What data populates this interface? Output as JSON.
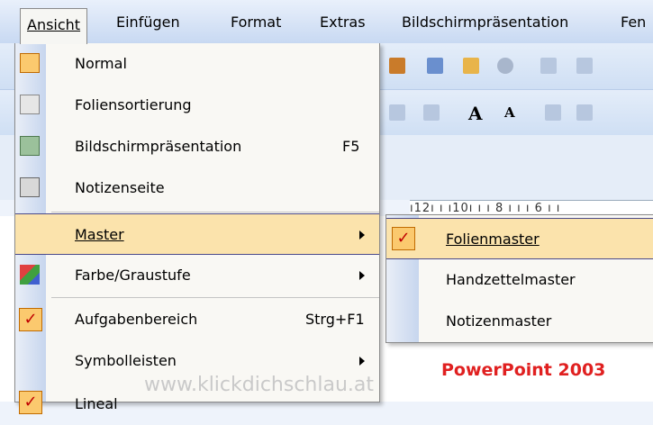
{
  "menubar": {
    "items": [
      {
        "label": "Ansicht"
      },
      {
        "label": "Einfügen"
      },
      {
        "label": "Format"
      },
      {
        "label": "Extras"
      },
      {
        "label": "Bildschirmpräsentation"
      },
      {
        "label": "Fen"
      }
    ]
  },
  "menu": {
    "items": [
      {
        "label": "Normal",
        "icon": "normal-view-icon"
      },
      {
        "label": "Foliensortierung",
        "icon": "slide-sorter-icon"
      },
      {
        "label": "Bildschirmpräsentation",
        "shortcut": "F5",
        "icon": "slideshow-icon"
      },
      {
        "label": "Notizenseite",
        "icon": "notes-page-icon"
      },
      {
        "label": "Master",
        "submenu": true
      },
      {
        "label": "Farbe/Graustufe",
        "submenu": true,
        "icon": "color-grayscale-icon"
      },
      {
        "label": "Aufgabenbereich",
        "shortcut": "Strg+F1",
        "checked": true
      },
      {
        "label": "Symbolleisten",
        "submenu": true
      },
      {
        "label": "Lineal",
        "checked": true
      }
    ]
  },
  "submenu": {
    "items": [
      {
        "label": "Folienmaster",
        "checked": true
      },
      {
        "label": "Handzettelmaster"
      },
      {
        "label": "Notizenmaster"
      }
    ]
  },
  "ruler": {
    "text": "ı12ı ı ı10ı ı ı 8 ı ı ı 6 ı ı"
  },
  "watermark": "www.klickdichschlau.at",
  "caption": "PowerPoint 2003",
  "colors": {
    "highlight": "#fbe3ac",
    "check": "#fbc96e",
    "caption": "#e02020"
  }
}
